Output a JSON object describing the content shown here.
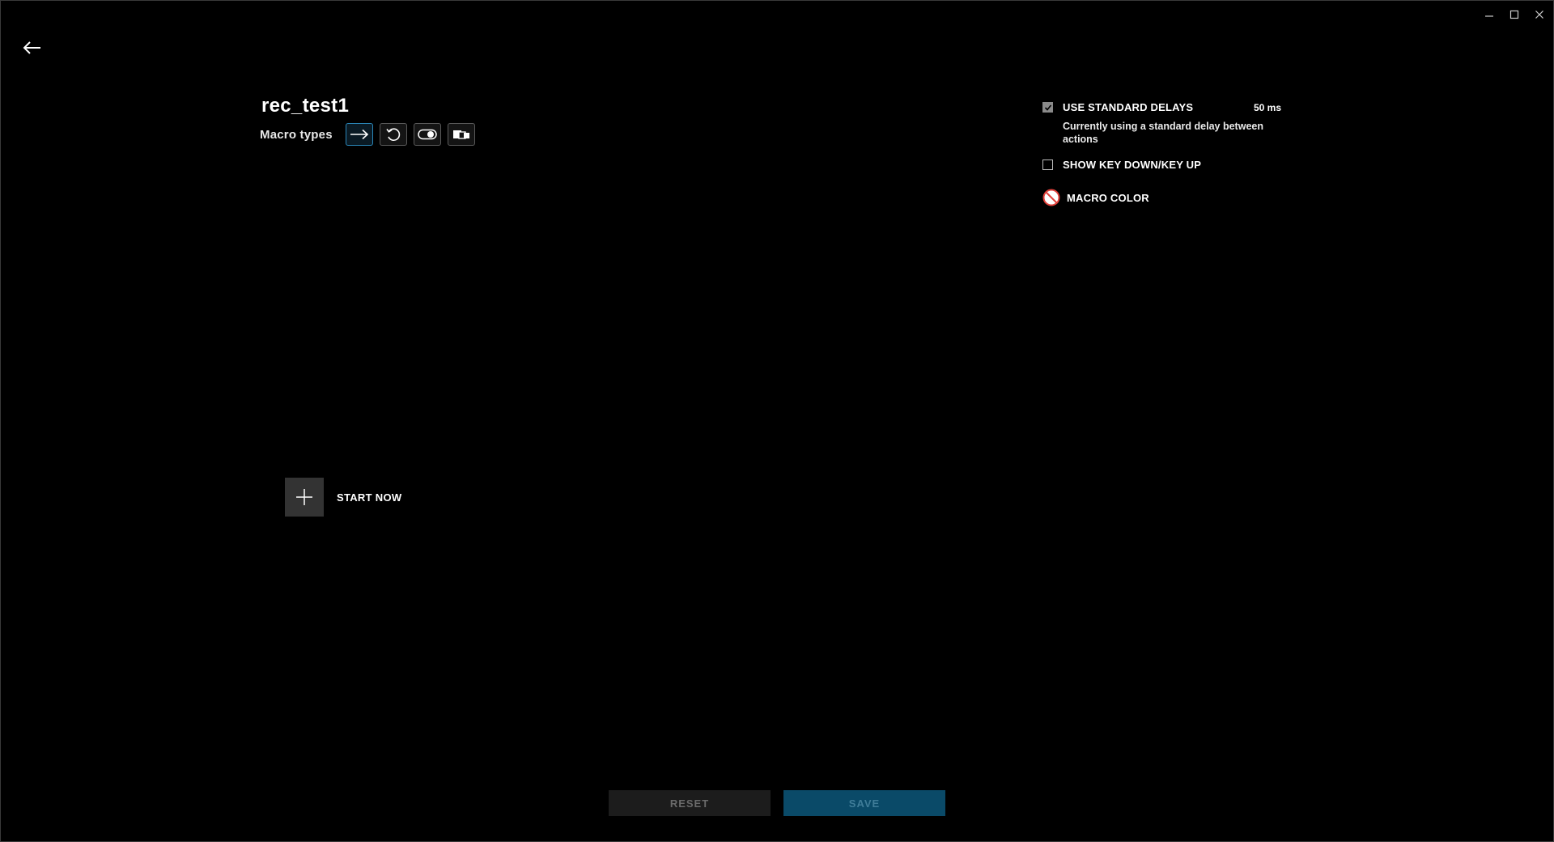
{
  "window": {
    "controls": {
      "minimize_icon": "minimize-icon",
      "maximize_icon": "maximize-icon",
      "close_icon": "close-icon"
    }
  },
  "header": {
    "back_icon": "arrow-left-icon",
    "title": "rec_test1"
  },
  "macro_types": {
    "label": "Macro types",
    "types": [
      {
        "icon": "arrow-right-icon",
        "selected": true
      },
      {
        "icon": "repeat-icon",
        "selected": false
      },
      {
        "icon": "toggle-icon",
        "selected": false
      },
      {
        "icon": "sequence-icon",
        "selected": false
      }
    ]
  },
  "options": {
    "standard_delays": {
      "label": "USE STANDARD DELAYS",
      "checked": true,
      "value": "50 ms",
      "description": "Currently using a standard delay between actions"
    },
    "key_down_up": {
      "label": "SHOW KEY DOWN/KEY UP",
      "checked": false
    },
    "macro_color": {
      "label": "MACRO COLOR",
      "icon": "no-color-icon",
      "color": "#e0403a"
    }
  },
  "start": {
    "label": "START NOW",
    "icon": "plus-icon"
  },
  "footer": {
    "reset_label": "RESET",
    "save_label": "SAVE"
  },
  "colors": {
    "background": "#000000",
    "accent": "#2a86b8",
    "save_bg": "#0a4a68",
    "reset_bg": "#1c1c1c"
  }
}
